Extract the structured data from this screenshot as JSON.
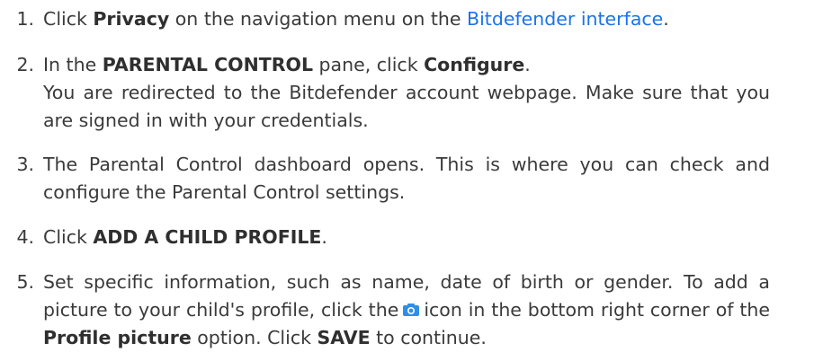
{
  "steps": [
    {
      "num": "1.",
      "pre": "Click ",
      "bold": "Privacy",
      "mid": " on the navigation menu on the ",
      "link": "Bitdefender interface",
      "post": "."
    },
    {
      "num": "2.",
      "pre": "In the ",
      "bold1": "PARENTAL CONTROL",
      "mid": " pane, click ",
      "bold2": "Configure",
      "post": ".",
      "note": "You are redirected to the Bitdefender account webpage. Make sure that you are signed in with your credentials."
    },
    {
      "num": "3.",
      "text": "The Parental Control dashboard opens. This is where you can check and configure the Parental Control settings."
    },
    {
      "num": "4.",
      "pre": "Click ",
      "bold": "ADD A CHILD PROFILE",
      "post": "."
    },
    {
      "num": "5.",
      "a": "Set specific information, such as name, date of birth or gender. To add a picture to your child's profile, click the",
      "icon": "camera-icon",
      "b": "icon in the bottom right corner of the ",
      "bold1": "Profile picture",
      "c": " option. Click ",
      "bold2": "SAVE",
      "d": " to continue."
    }
  ],
  "colors": {
    "text": "#3a3a3a",
    "link": "#1a73e8",
    "icon": "#2f8fe6"
  }
}
